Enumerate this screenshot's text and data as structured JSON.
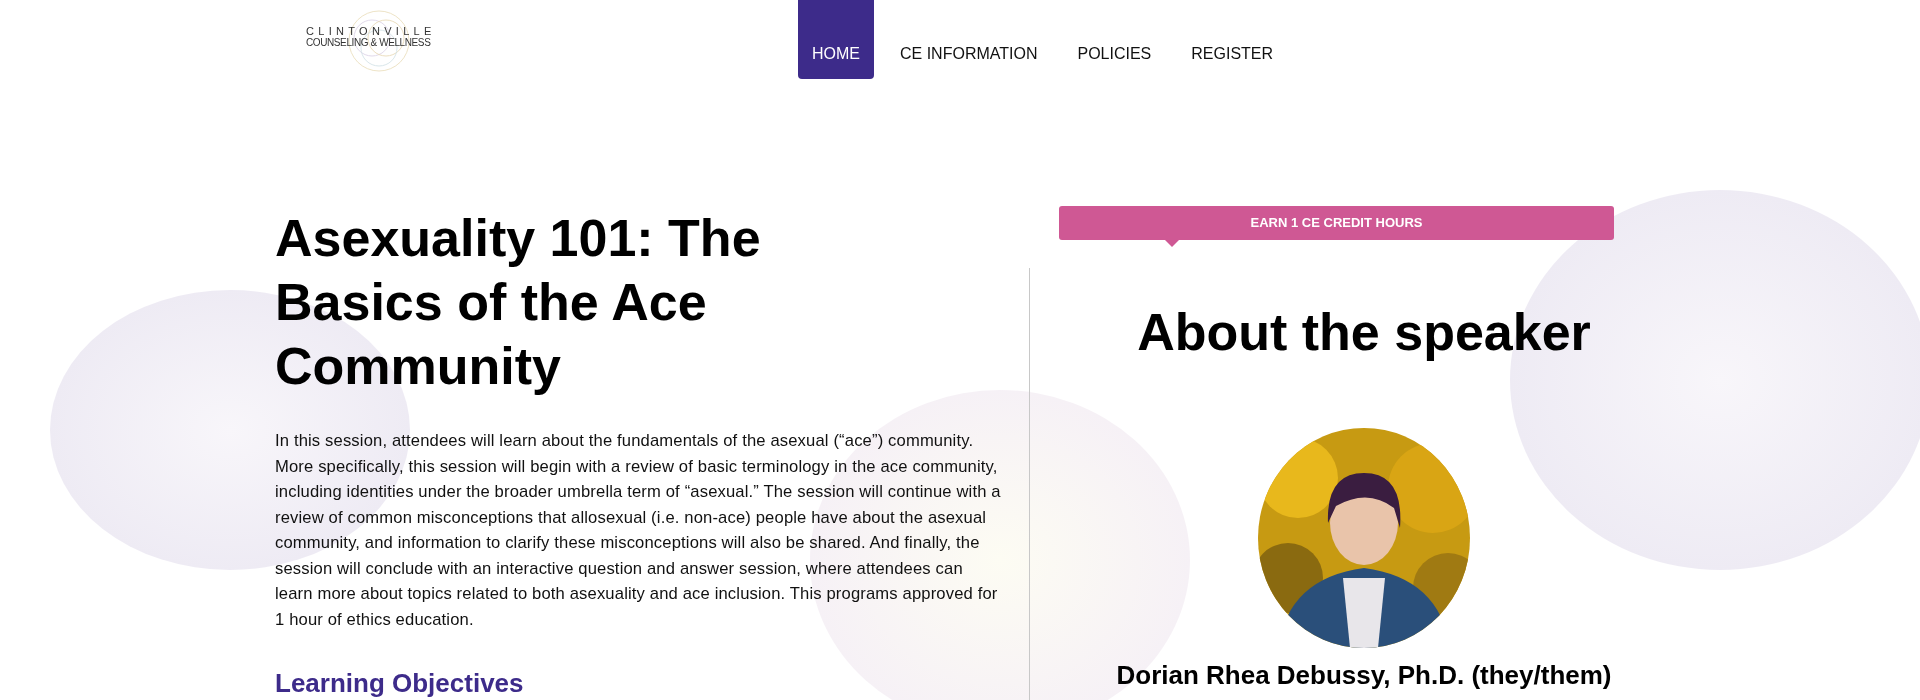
{
  "logo": {
    "line1": "CLINTONVILLE",
    "line2": "COUNSELING & WELLNESS"
  },
  "nav": [
    {
      "label": "HOME",
      "selected": true
    },
    {
      "label": "CE INFORMATION",
      "selected": false
    },
    {
      "label": "POLICIES",
      "selected": false
    },
    {
      "label": "REGISTER",
      "selected": false
    }
  ],
  "course": {
    "title": "Asexuality 101: The Basics of the Ace Community",
    "description": "In this session, attendees will learn about the fundamentals of the asexual (“ace”) community. More specifically, this session will begin with a review of basic terminology in the ace community, including identities under the broader umbrella term of “asexual.” The session will continue with a review of common misconceptions that allosexual (i.e. non-ace) people have about the asexual community, and information to clarify these misconceptions will also be shared. And finally, the session will conclude with an interactive question and answer session, where attendees can learn more about topics related to both asexuality and ace inclusion. This programs approved for 1 hour of ethics education.",
    "objectives_heading": "Learning Objectives"
  },
  "credit_banner": "EARN 1 CE CREDIT HOURS",
  "speaker": {
    "heading": "About the speaker",
    "name": "Dorian Rhea Debussy, Ph.D. (they/them)"
  }
}
